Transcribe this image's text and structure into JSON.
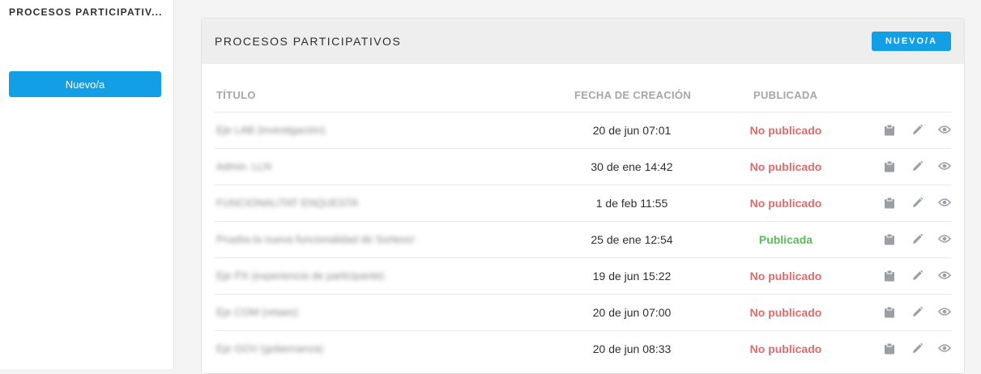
{
  "sidebar": {
    "title": "PROCESOS PARTICIPATIV...",
    "new_button": "Nuevo/a"
  },
  "main": {
    "title": "PROCESOS PARTICIPATIVOS",
    "new_button": "NUEVO/A",
    "columns": {
      "title": "TÍTULO",
      "created": "FECHA DE CREACIÓN",
      "published": "PUBLICADA"
    },
    "rows": [
      {
        "title": "Eje LAB (investigación)",
        "date": "20 de jun 07:01",
        "status": "No publicado",
        "published": false
      },
      {
        "title": "Admin. LLN",
        "date": "30 de ene 14:42",
        "status": "No publicado",
        "published": false
      },
      {
        "title": "FUNCIONALITAT ENQUESTA",
        "date": "1 de feb 11:55",
        "status": "No publicado",
        "published": false
      },
      {
        "title": "Prueba la nueva funcionalidad de Sorteos!",
        "date": "25 de ene 12:54",
        "status": "Publicada",
        "published": true
      },
      {
        "title": "Eje PX (experiencia de participante)",
        "date": "19 de jun 15:22",
        "status": "No publicado",
        "published": false
      },
      {
        "title": "Eje COM (retaes)",
        "date": "20 de jun 07:00",
        "status": "No publicado",
        "published": false
      },
      {
        "title": "Eje GOV (gobernanza)",
        "date": "20 de jun 08:33",
        "status": "No publicado",
        "published": false
      }
    ],
    "row_actions": [
      "clipboard-icon",
      "pencil-icon",
      "eye-icon"
    ]
  },
  "colors": {
    "accent": "#139fe5",
    "unpublished": "#de6b6b",
    "published": "#5cb85c",
    "icon": "#9a9fa5"
  }
}
